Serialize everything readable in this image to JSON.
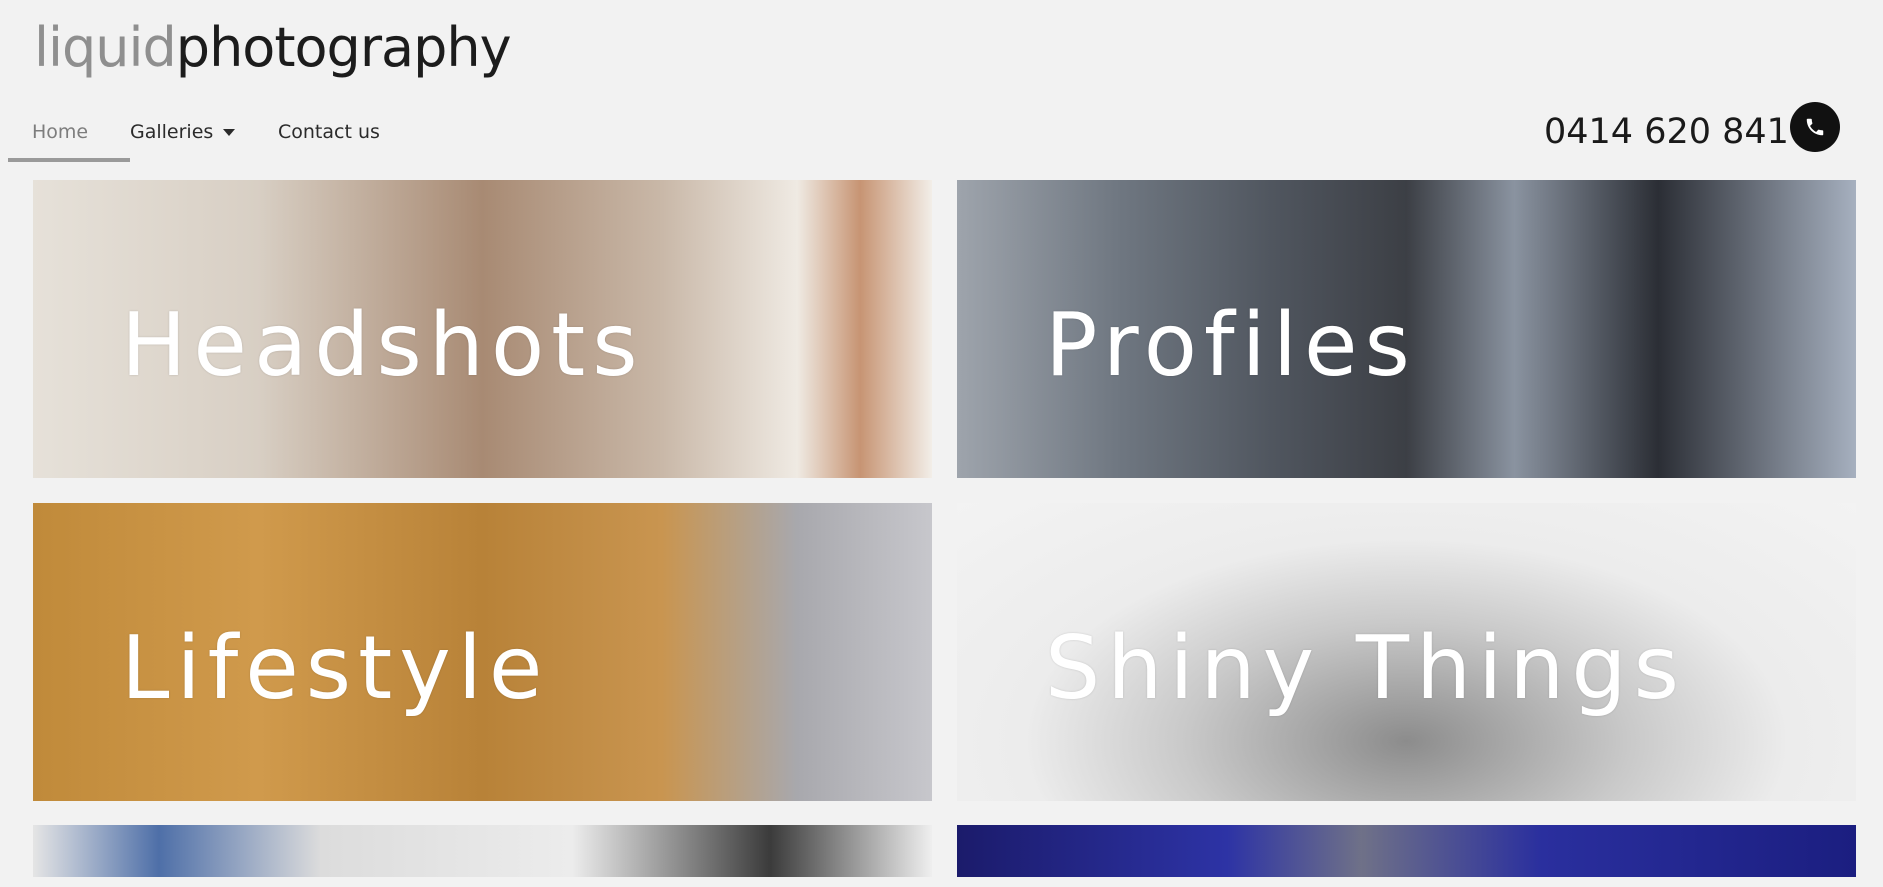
{
  "logo": {
    "part1": "liquid",
    "part2": "photography"
  },
  "nav": {
    "items": [
      {
        "label": "Home",
        "active": true
      },
      {
        "label": "Galleries",
        "active": false,
        "has_dropdown": true
      },
      {
        "label": "Contact us",
        "active": false
      }
    ]
  },
  "header": {
    "phone": "0414 620 841",
    "phone_icon": "phone-icon"
  },
  "tiles": [
    {
      "label": "Headshots"
    },
    {
      "label": "Profiles"
    },
    {
      "label": "Lifestyle"
    },
    {
      "label": "Shiny Things"
    },
    {
      "label": ""
    },
    {
      "label": ""
    }
  ],
  "colors": {
    "background": "#f2f2f2",
    "nav_active": "#7d7d7d",
    "tile_text": "#ffffff",
    "phone_button": "#111111"
  }
}
